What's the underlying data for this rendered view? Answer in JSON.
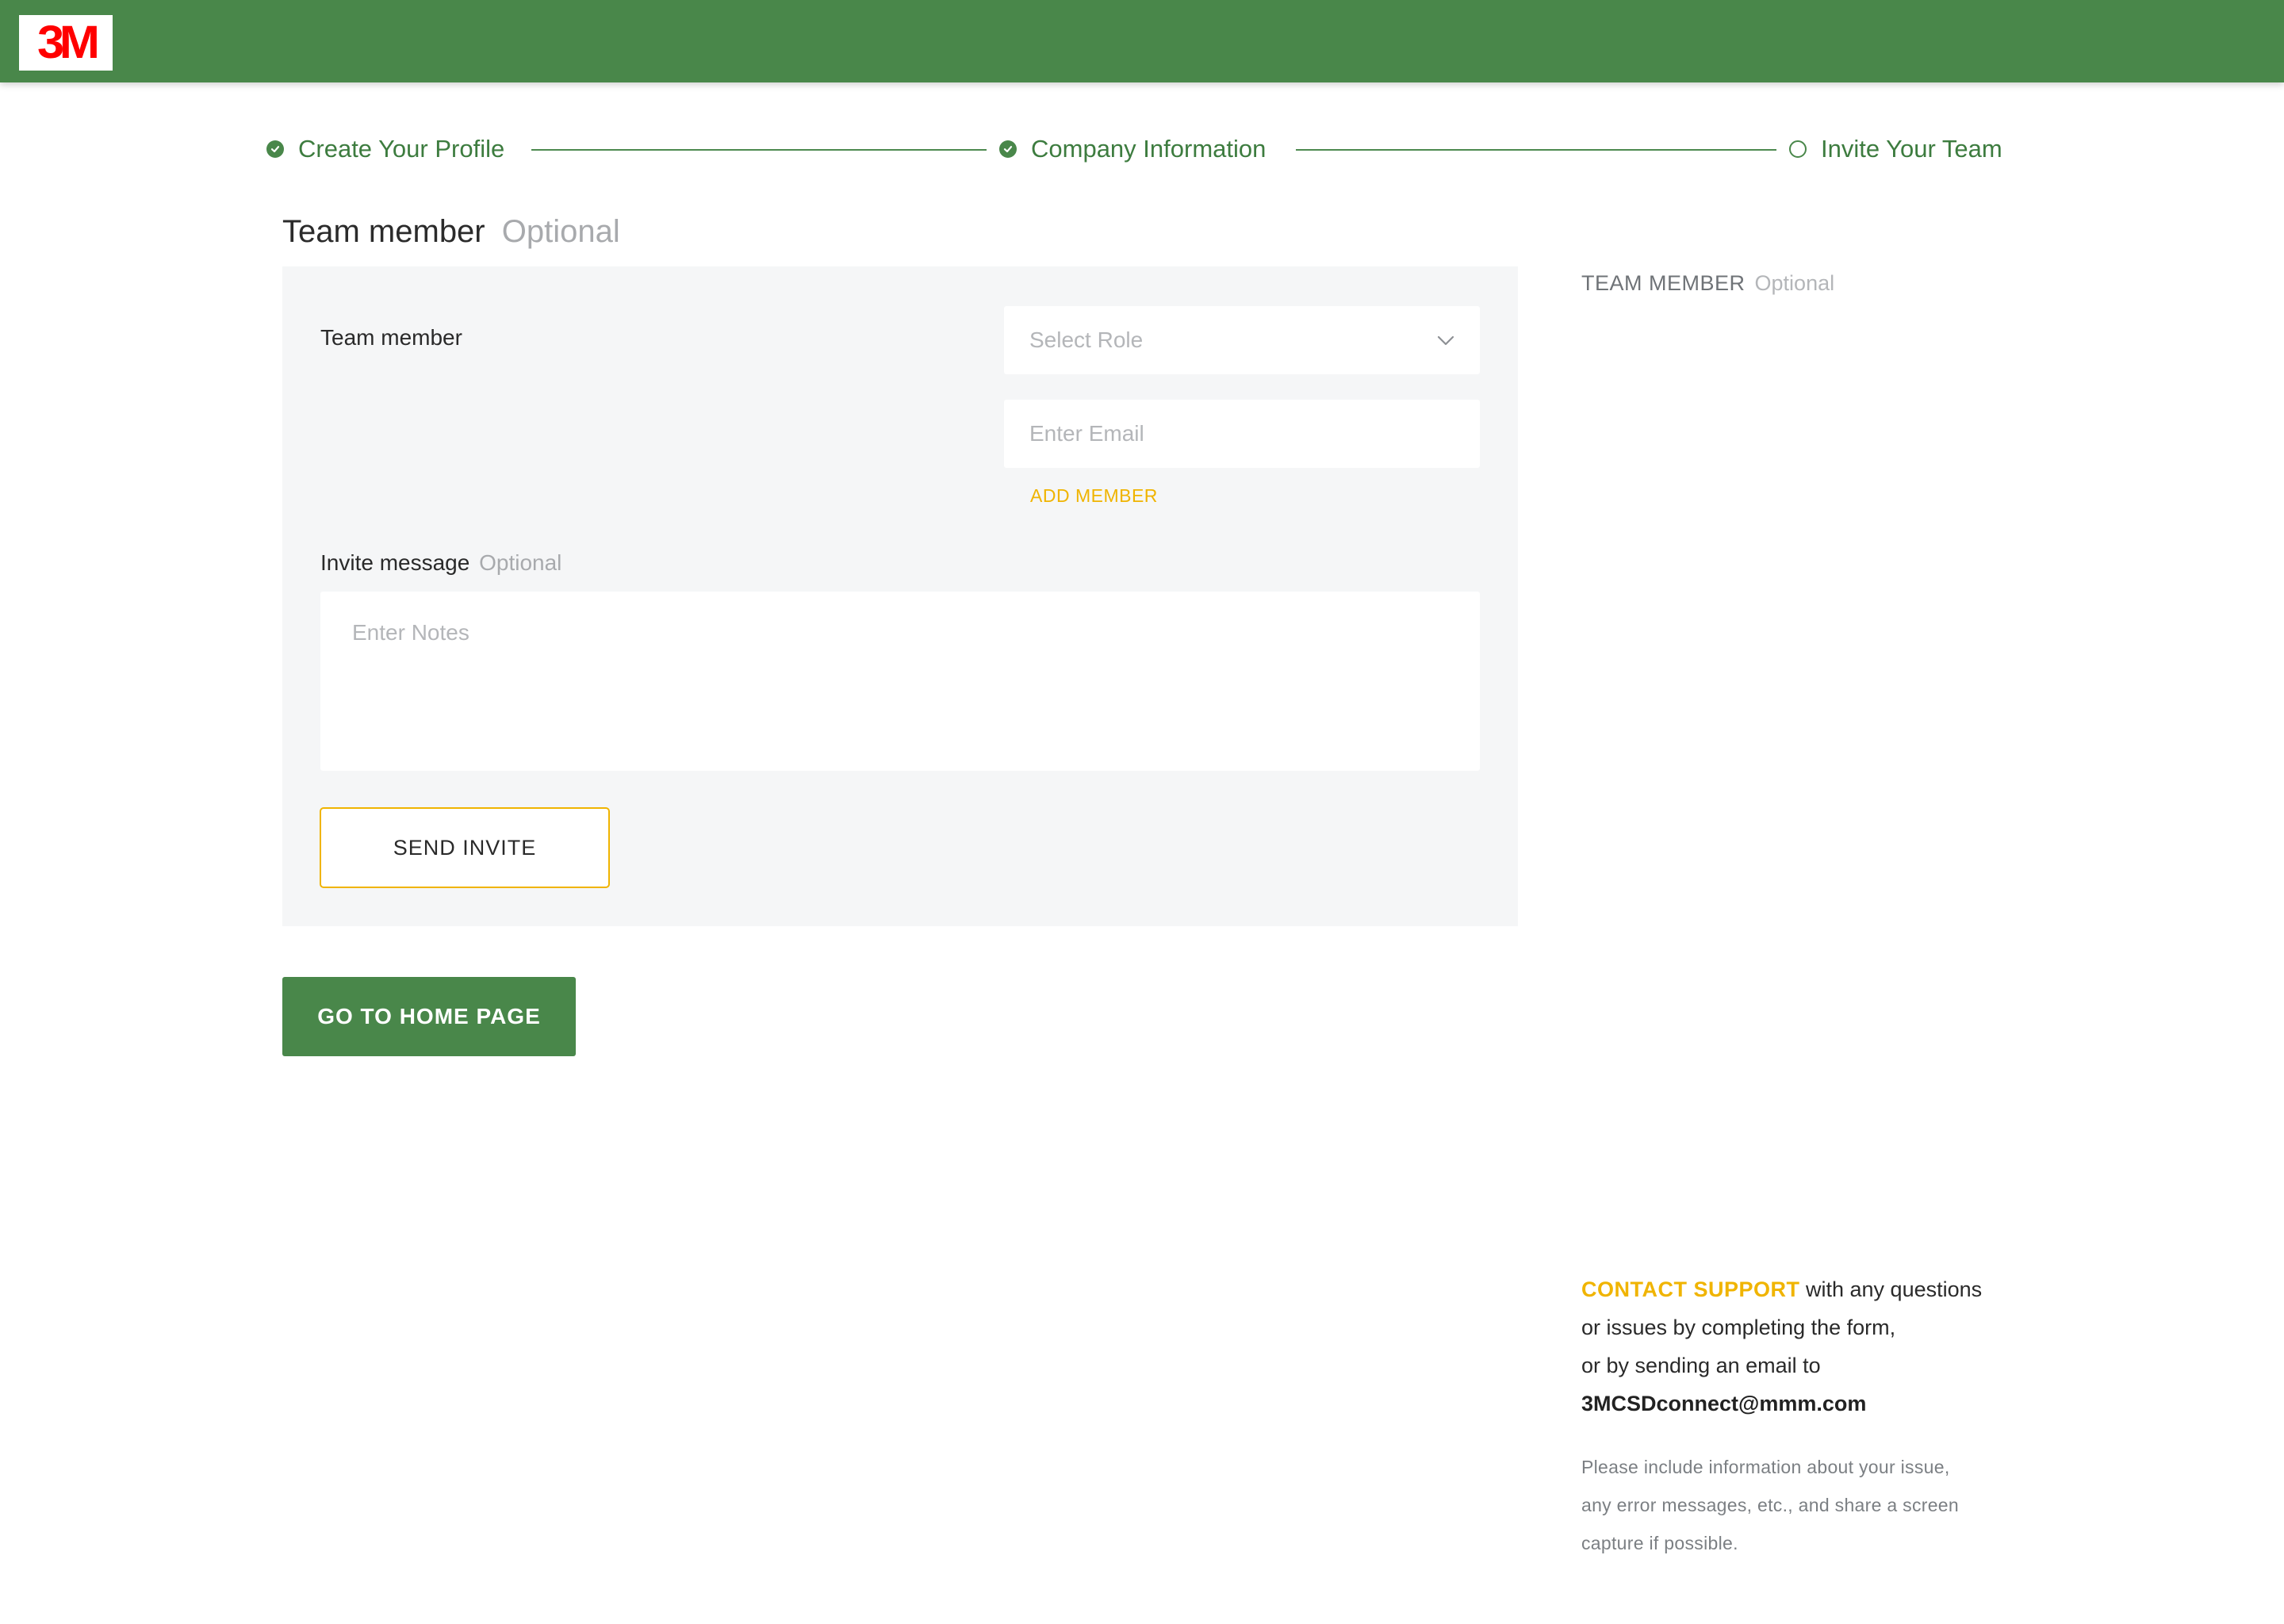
{
  "header": {
    "logo_text": "3M",
    "brand_colors": {
      "bar": "#49874a",
      "logo": "#ff0000"
    }
  },
  "stepper": {
    "steps": [
      {
        "label": "Create Your Profile",
        "status": "complete",
        "icon": "check-circle-icon"
      },
      {
        "label": "Company Information",
        "status": "complete",
        "icon": "check-circle-icon"
      },
      {
        "label": "Invite Your Team",
        "status": "current",
        "icon": "empty-circle-icon"
      }
    ]
  },
  "section": {
    "title": "Team member",
    "title_suffix": "Optional"
  },
  "form": {
    "team_member_label": "Team member",
    "role_select": {
      "placeholder": "Select Role",
      "icon": "chevron-down-icon"
    },
    "email_input": {
      "value": "",
      "placeholder": "Enter Email"
    },
    "add_member_label": "ADD MEMBER",
    "invite_message_label": "Invite message",
    "invite_message_suffix": "Optional",
    "notes_input": {
      "value": "",
      "placeholder": "Enter Notes"
    },
    "send_invite_label": "SEND INVITE"
  },
  "actions": {
    "home_label": "GO TO HOME PAGE"
  },
  "sidebar": {
    "title": "TEAM MEMBER",
    "title_suffix": "Optional"
  },
  "support": {
    "link_label": "CONTACT SUPPORT",
    "text_1": " with any questions",
    "text_2": "or issues by completing the form,",
    "text_3": "or by sending an email to",
    "email": "3MCSDconnect@mmm.com",
    "note_1": "Please include information about your issue,",
    "note_2": "any error messages, etc., and share a screen",
    "note_3": "capture if possible."
  },
  "colors": {
    "primary_green": "#49874a",
    "accent_yellow": "#f0b400",
    "panel_bg": "#f5f6f7"
  }
}
